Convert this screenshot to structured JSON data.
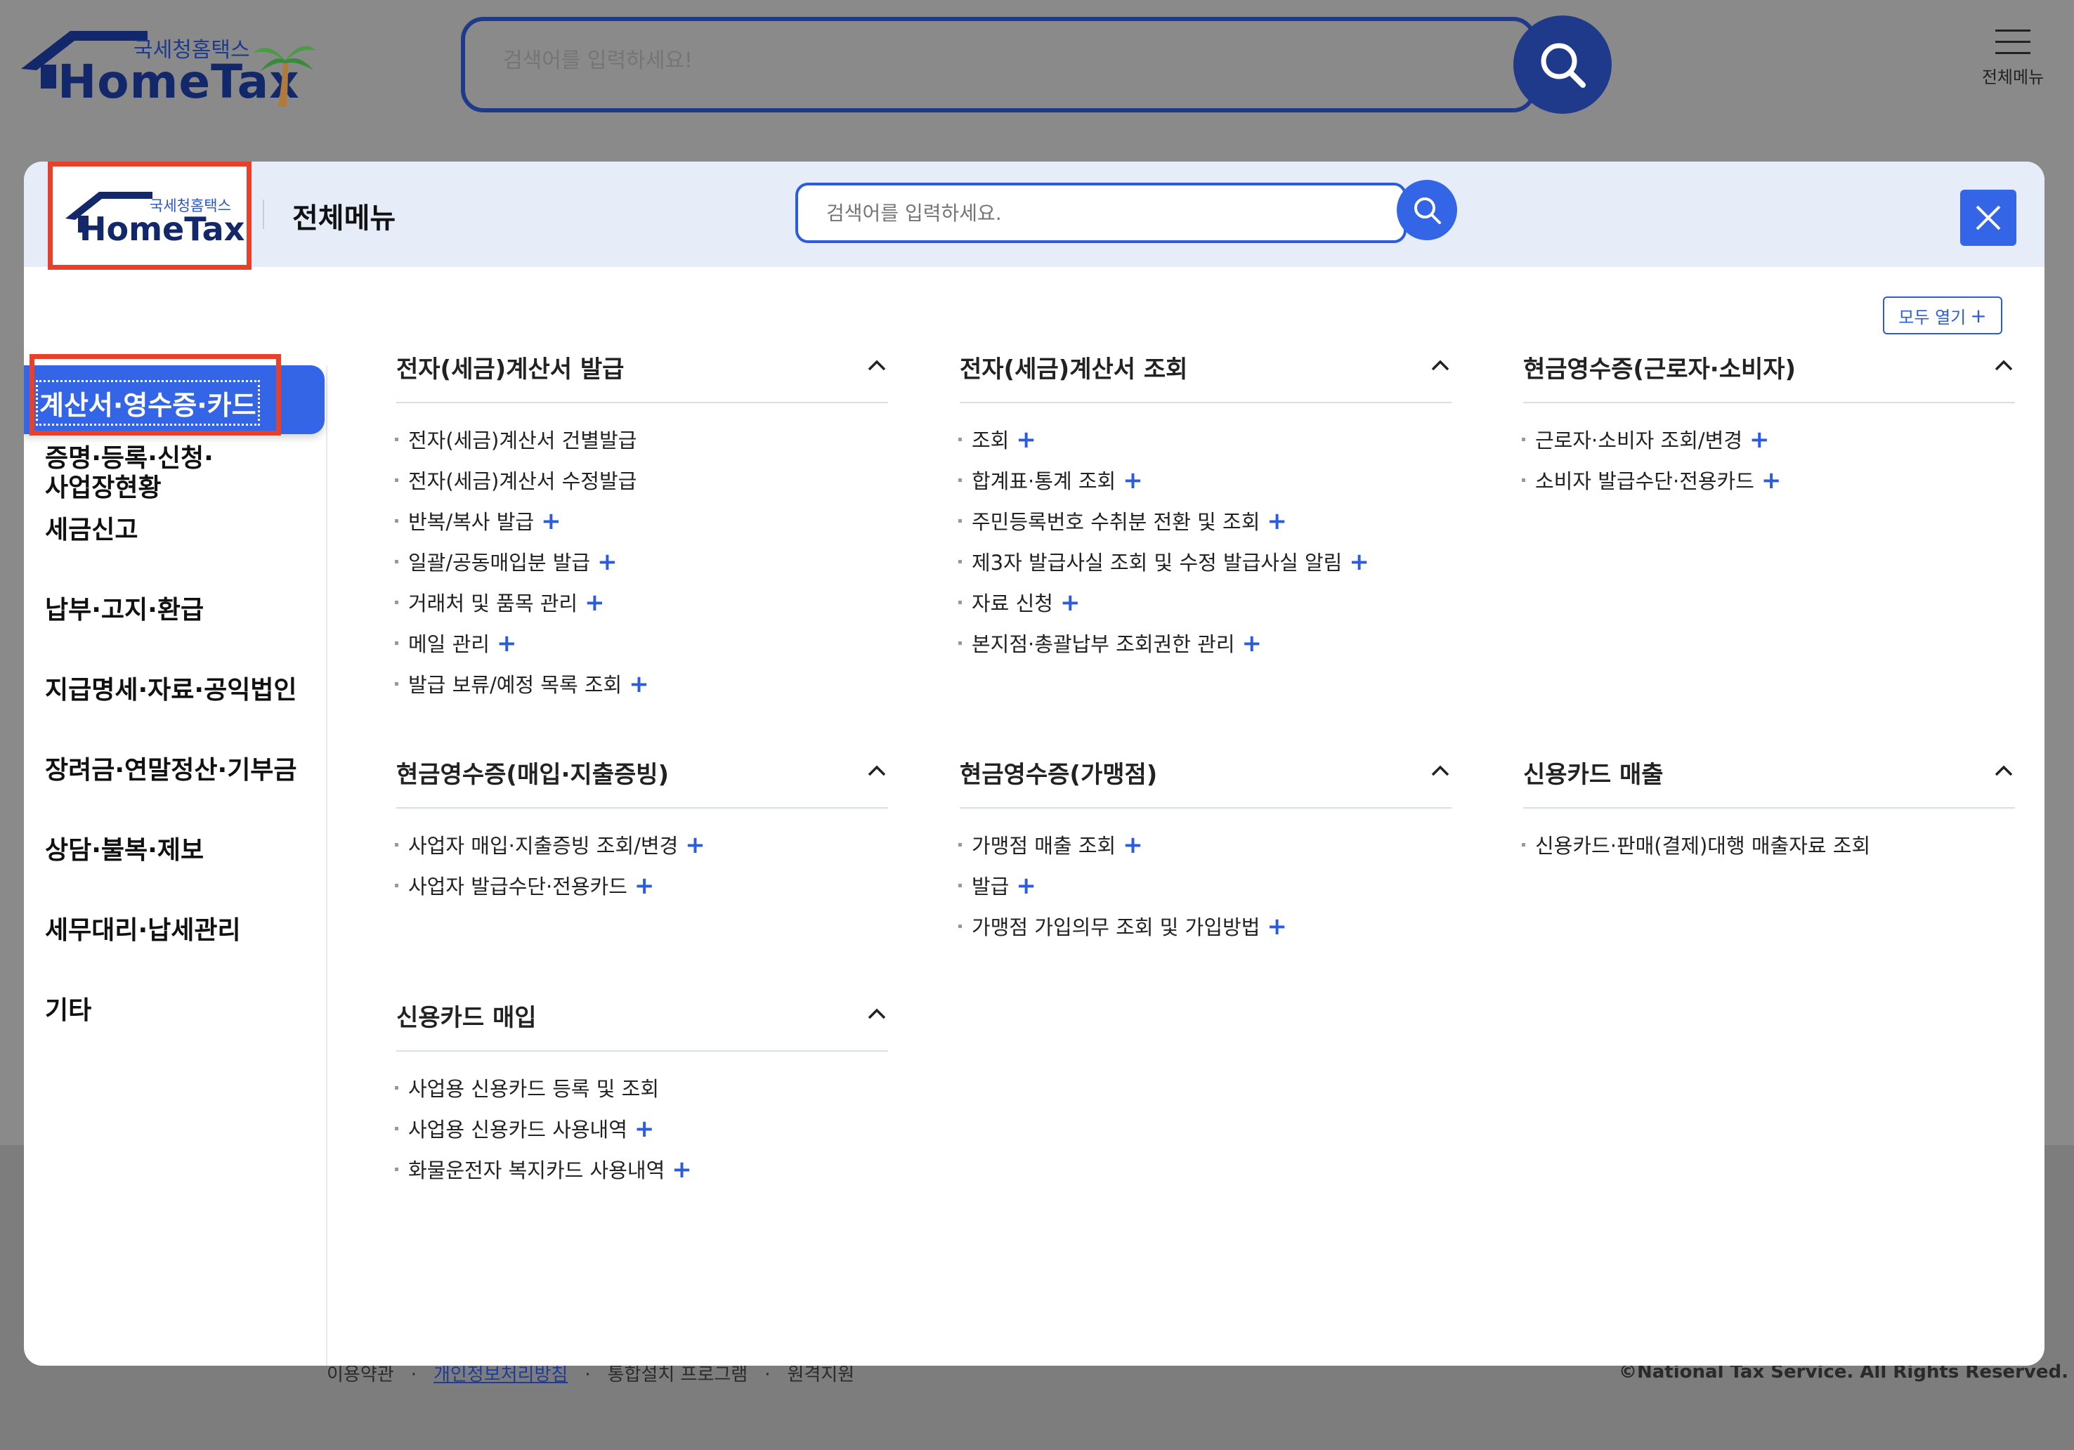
{
  "background": {
    "logo": {
      "korean": "국세청홈택스",
      "english": "HomeTax"
    },
    "search": {
      "placeholder": "검색어를 입력하세요!"
    },
    "menu_label": "전체메뉴",
    "footer": {
      "links": [
        "이용약관",
        "개인정보처리방침",
        "통합설치 프로그램",
        "원격지원"
      ],
      "copyright": "©National Tax Service. All Rights Reserved."
    }
  },
  "modal": {
    "logo": {
      "korean": "국세청홈택스",
      "english": "HomeTax"
    },
    "title": "전체메뉴",
    "search": {
      "placeholder": "검색어를 입력하세요."
    },
    "open_all": "모두 열기",
    "sidebar": {
      "active": "계산서·영수증·카드",
      "items": [
        "증명·등록·신청·",
        "사업장현황",
        "세금신고",
        "납부·고지·환급",
        "지급명세·자료·공익법인",
        "장려금·연말정산·기부금",
        "상담·불복·제보",
        "세무대리·납세관리",
        "기타"
      ]
    },
    "sections": [
      {
        "title": "전자(세금)계산서 발급",
        "items": [
          {
            "label": "전자(세금)계산서 건별발급",
            "plus": false
          },
          {
            "label": "전자(세금)계산서 수정발급",
            "plus": false
          },
          {
            "label": "반복/복사 발급",
            "plus": true
          },
          {
            "label": "일괄/공동매입분 발급",
            "plus": true
          },
          {
            "label": "거래처 및 품목 관리",
            "plus": true
          },
          {
            "label": "메일 관리",
            "plus": true
          },
          {
            "label": "발급 보류/예정 목록 조회",
            "plus": true
          }
        ]
      },
      {
        "title": "전자(세금)계산서 조회",
        "items": [
          {
            "label": "조회",
            "plus": true
          },
          {
            "label": "합계표·통계 조회",
            "plus": true
          },
          {
            "label": "주민등록번호 수취분 전환 및 조회",
            "plus": true
          },
          {
            "label": "제3자 발급사실 조회 및 수정 발급사실 알림",
            "plus": true
          },
          {
            "label": "자료 신청",
            "plus": true
          },
          {
            "label": "본지점·총괄납부 조회권한 관리",
            "plus": true
          }
        ]
      },
      {
        "title": "현금영수증(근로자·소비자)",
        "items": [
          {
            "label": "근로자·소비자 조회/변경",
            "plus": true
          },
          {
            "label": "소비자 발급수단·전용카드",
            "plus": true
          }
        ]
      },
      {
        "title": "현금영수증(매입·지출증빙)",
        "items": [
          {
            "label": "사업자 매입·지출증빙 조회/변경",
            "plus": true
          },
          {
            "label": "사업자 발급수단·전용카드",
            "plus": true
          }
        ]
      },
      {
        "title": "현금영수증(가맹점)",
        "items": [
          {
            "label": "가맹점 매출 조회",
            "plus": true
          },
          {
            "label": "발급",
            "plus": true
          },
          {
            "label": "가맹점 가입의무 조회 및 가입방법",
            "plus": true
          }
        ]
      },
      {
        "title": "신용카드 매출",
        "items": [
          {
            "label": "신용카드·판매(결제)대행 매출자료 조회",
            "plus": false
          }
        ]
      },
      {
        "title": "신용카드 매입",
        "items": [
          {
            "label": "사업용 신용카드 등록 및 조회",
            "plus": false
          },
          {
            "label": "사업용 신용카드 사용내역",
            "plus": true
          },
          {
            "label": "화물운전자 복지카드 사용내역",
            "plus": true
          }
        ]
      }
    ]
  },
  "colors": {
    "brand_navy": "#13286a",
    "accent_blue": "#3365e6",
    "highlight_red": "#e8412b"
  }
}
